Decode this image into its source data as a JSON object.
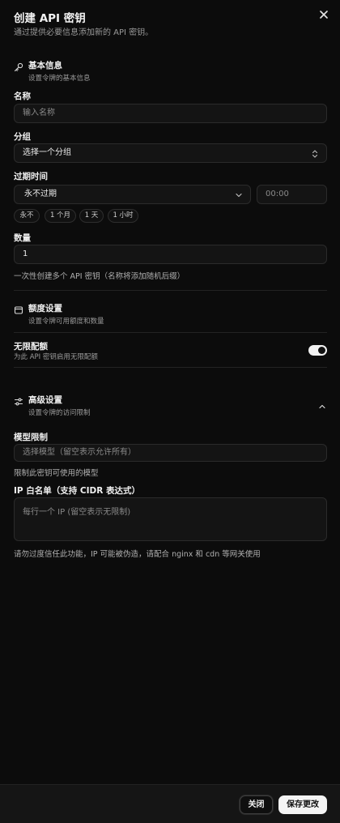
{
  "header": {
    "title": "创建 API 密钥",
    "subtitle": "通过提供必要信息添加新的 API 密钥。"
  },
  "basic": {
    "title": "基本信息",
    "desc": "设置令牌的基本信息",
    "name_label": "名称",
    "name_placeholder": "输入名称",
    "group_label": "分组",
    "group_placeholder": "选择一个分组",
    "expire_label": "过期时间",
    "expire_value": "永不过期",
    "time_value": "00:00",
    "quick_options": [
      "永不",
      "1 个月",
      "1 天",
      "1 小时"
    ],
    "qty_label": "数量",
    "qty_value": "1",
    "qty_help": "一次性创建多个 API 密钥（名称将添加随机后缀）"
  },
  "quota": {
    "title": "额度设置",
    "desc": "设置令牌可用额度和数量",
    "unlimited_label": "无限配额",
    "unlimited_desc": "为此 API 密钥启用无限配额",
    "unlimited_on": true
  },
  "advanced": {
    "title": "高级设置",
    "desc": "设置令牌的访问限制",
    "model_label": "模型限制",
    "model_placeholder": "选择模型（留空表示允许所有）",
    "model_help": "限制此密钥可使用的模型",
    "ip_label": "IP 白名单（支持 CIDR 表达式）",
    "ip_placeholder": "每行一个 IP (留空表示无限制)",
    "ip_help": "请勿过度信任此功能，IP 可能被伪造，请配合 nginx 和 cdn 等网关使用"
  },
  "footer": {
    "close_label": "关闭",
    "save_label": "保存更改"
  }
}
